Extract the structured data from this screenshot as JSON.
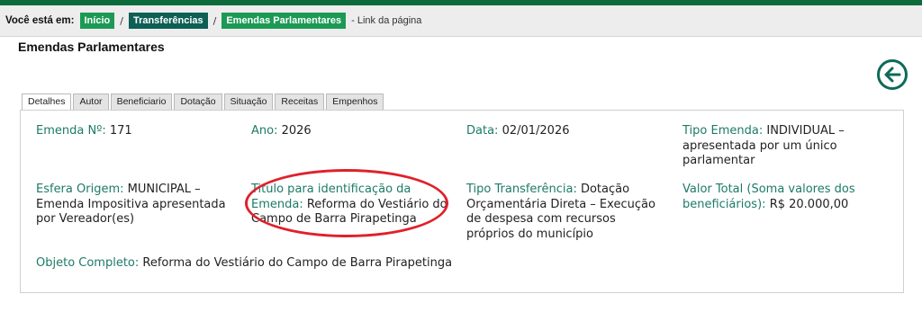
{
  "breadcrumb": {
    "label": "Você está em:",
    "items": [
      "Início",
      "Transferências",
      "Emendas Parlamentares"
    ],
    "separator": "/",
    "trailing": "- Link da página"
  },
  "page_title": "Emendas Parlamentares",
  "tabs": [
    "Detalhes",
    "Autor",
    "Beneficiario",
    "Dotação",
    "Situação",
    "Receitas",
    "Empenhos"
  ],
  "fields": {
    "emenda_no": {
      "label": "Emenda Nº:",
      "value": "171"
    },
    "ano": {
      "label": "Ano:",
      "value": "2026"
    },
    "data": {
      "label": "Data:",
      "value": "02/01/2026"
    },
    "tipo_emenda": {
      "label": "Tipo Emenda:",
      "value": "INDIVIDUAL – apresentada por um único parlamentar"
    },
    "esfera_origem": {
      "label": "Esfera Origem:",
      "value": "MUNICIPAL – Emenda Impositiva apresentada por Vereador(es)"
    },
    "titulo": {
      "label": "Titulo para identificação da Emenda:",
      "value": "Reforma do Vestiário do Campo de Barra Pirapetinga"
    },
    "tipo_transferencia": {
      "label": "Tipo Transferência:",
      "value": "Dotação Orçamentária Direta – Execução de despesa com recursos próprios do município"
    },
    "valor_total": {
      "label": "Valor Total (Soma valores dos beneficiários):",
      "value": "R$ 20.000,00"
    },
    "objeto_completo": {
      "label": "Objeto Completo:",
      "value": "Reforma do Vestiário do Campo de Barra Pirapetinga"
    }
  },
  "icons": {
    "back": "arrow-left-circle-icon"
  },
  "colors": {
    "nav_green": "#0b6b3a",
    "chip_green": "#1c9a55",
    "chip_teal": "#0e5f55",
    "label_teal": "#1d7a68",
    "annotation_red": "#e0202a"
  }
}
